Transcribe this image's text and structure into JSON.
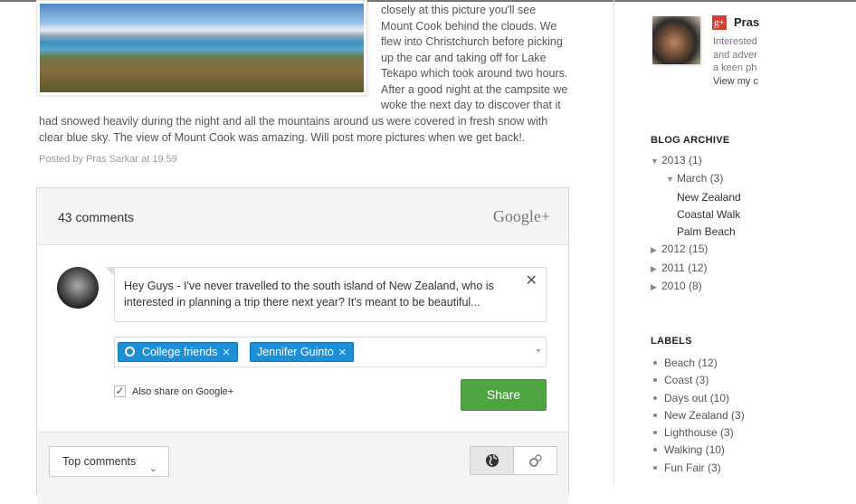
{
  "post": {
    "lines_right": [
      "closely at this picture you'll see",
      "Mount Cook behind the clouds. We",
      "flew into Christchurch before picking",
      "up the car and taking off for Lake",
      "Tekapo which took around two hours.",
      "After a good night at the campsite we",
      "woke the next day to discover that it"
    ],
    "lines_full": [
      "had snowed heavily during the night and all the mountains around us were covered in fresh snow with",
      "clear blue sky. The view of Mount Cook was amazing. Will post more pictures when we get back!."
    ],
    "posted_by": "Posted by Pras Sarkar at 19.59"
  },
  "comments": {
    "count": "43 comments",
    "brand": "Google+",
    "draft": "Hey Guys - I've never travelled to the south island of New Zealand, who is interested in planning a trip there next year? It's meant to be beautiful...",
    "recipients": [
      "College friends",
      "Jennifer Guinto"
    ],
    "also_share": "Also share on Google+",
    "share_label": "Share",
    "sort_label": "Top comments"
  },
  "profile": {
    "name": "Pras",
    "desc": [
      "Interested",
      "and adver",
      "a keen ph",
      "View my c"
    ]
  },
  "archive": {
    "title": "BLOG ARCHIVE",
    "items": [
      {
        "label": "2013 (1)",
        "arrow": "▼",
        "level": 0
      },
      {
        "label": "March (3)",
        "arrow": "▼",
        "level": 1
      },
      {
        "label": "New Zealand",
        "arrow": "",
        "level": 2
      },
      {
        "label": "Coastal Walk",
        "arrow": "",
        "level": 2
      },
      {
        "label": "Palm Beach",
        "arrow": "",
        "level": 2
      },
      {
        "label": "2012 (15)",
        "arrow": "▶",
        "level": 0
      },
      {
        "label": "2011 (12)",
        "arrow": "▶",
        "level": 0
      },
      {
        "label": "2010 (8)",
        "arrow": "▶",
        "level": 0
      }
    ]
  },
  "labels": {
    "title": "LABELS",
    "items": [
      "Beach (12)",
      "Coast (3)",
      "Days out (10)",
      "New Zealand (3)",
      "Lighthouse (3)",
      "Walking (10)",
      "Fun Fair (3)"
    ]
  }
}
